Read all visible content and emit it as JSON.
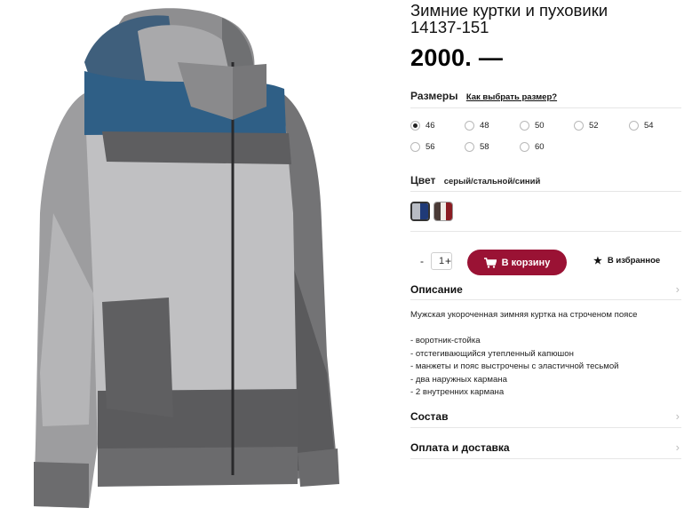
{
  "product": {
    "title_line1": "Зимние куртки и пуховики",
    "title_line2": "14137-151",
    "price": "2000. —"
  },
  "sizes": {
    "heading": "Размеры",
    "guide_link": "Как выбрать размер?",
    "options": [
      "46",
      "48",
      "50",
      "52",
      "54",
      "56",
      "58",
      "60"
    ],
    "selected": "46"
  },
  "color": {
    "heading": "Цвет",
    "value": "серый/стальной/синий",
    "swatches": [
      {
        "colors": [
          "#b8bcc4",
          "#1f3a78"
        ],
        "selected": true
      },
      {
        "colors": [
          "#4a3a36",
          "#f0ece6",
          "#8a1c22"
        ],
        "selected": false
      }
    ]
  },
  "purchase": {
    "qty_minus": "-",
    "qty_value": "1",
    "qty_plus": "+",
    "cart_label": "В корзину",
    "favorite_label": "В избранное",
    "accent_color": "#9a1234"
  },
  "description": {
    "heading": "Описание",
    "intro": "Мужская укороченная зимняя куртка на строченом поясе",
    "features": [
      "- воротник-стойка",
      "- отстегивающийся утепленный капюшон",
      "- манжеты и пояс выстрочены с эластичной тесьмой",
      "- два наружных кармана",
      "- 2 внутренних кармана"
    ]
  },
  "composition": {
    "heading": "Состав"
  },
  "delivery": {
    "heading": "Оплата и доставка"
  }
}
